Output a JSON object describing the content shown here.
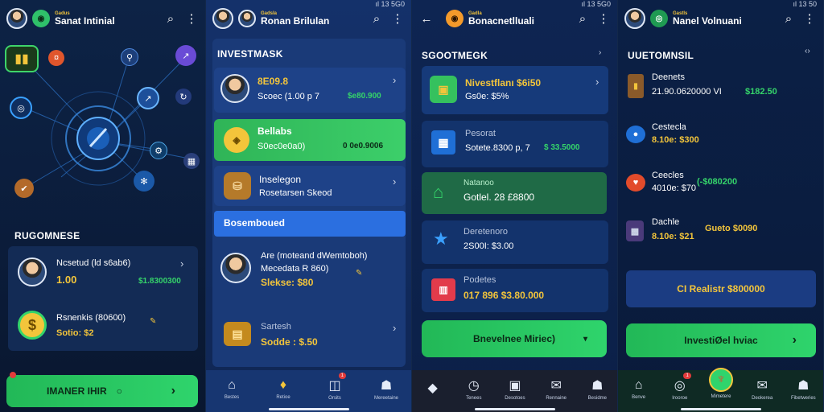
{
  "panels": [
    {
      "brand_small": "Gadus",
      "brand_name": "Sanat Intinial",
      "section_title": "RUGOMNESE",
      "items": [
        {
          "title": "Ncsetud (ld s6ab6)",
          "value": "1.00",
          "amount": "$1.8300300"
        },
        {
          "title": "Rsnenkis (80600)",
          "value": "Sotio: $2",
          "amount": ""
        }
      ],
      "cta": "IMANER IHIR",
      "nav": [
        "",
        "",
        "",
        "",
        ""
      ]
    },
    {
      "status": "ıl 13 5G0",
      "brand_small": "Gadsla",
      "brand_name": "Ronan Brilulan",
      "section_title": "INVESTMASK",
      "items": [
        {
          "line1": "8E09.8",
          "line2": "Scoec (1.00 p 7",
          "amount": "$e80.900"
        },
        {
          "line1": "Bellabs",
          "line2": "S0ec0e0a0)",
          "amount": "0 0e0.9006"
        },
        {
          "line1": "Inselegon",
          "line2": "Rosetarsen Skeod",
          "amount": ""
        },
        {
          "line1": "Are (moteand dWemtoboh)",
          "line2": "Mecedata R 860)",
          "line3": "Slekse: $80"
        },
        {
          "line1": "Sartesh",
          "line2": "Sodde : $.50"
        }
      ],
      "highlight": "Bosemboued",
      "nav": [
        "Bestes",
        "Retioe",
        "Orsits",
        "Mereetaine"
      ],
      "badge": "1"
    },
    {
      "status": "ıl 13 5G0",
      "brand_small": "Gadla",
      "brand_name": "Bonacnetlluali",
      "section_title": "SGOOTMEGK",
      "items": [
        {
          "line1": "Nivestflanı $6i50",
          "line2": "Gs0e: $5%"
        },
        {
          "line1": "Pesorat",
          "line2": "Sotete.8300 p, 7",
          "amount": "$ 33.5000"
        },
        {
          "line1": "Natanoo",
          "line2": "Gotlel. 28 £8800"
        },
        {
          "line1": "Deretenoro",
          "line2": "2S00I: $3.00"
        },
        {
          "line1": "Podetes",
          "line2": "017 896 $3.80.000"
        }
      ],
      "cta": "Bnevelnee Miriec)",
      "nav": [
        "",
        "Tenees",
        "Desotoes",
        "Rennaine",
        "Besidme"
      ]
    },
    {
      "status": "ıl 13 50",
      "brand_small": "Gastls",
      "brand_name": "Nanel Volnuani",
      "section_title": "UUETOMNSIL",
      "items": [
        {
          "line1": "Deenets",
          "line2": "21.90.0620000 VI",
          "amount": "$182.50"
        },
        {
          "line1": "Cestecla",
          "line2": "8.10e: $300"
        },
        {
          "line1": "Ceecles",
          "line2": "4010e: $70",
          "amount": "(-$080200"
        },
        {
          "line1": "Dachle",
          "line2": "8.10e: $21",
          "amount": "Gueto $0090"
        }
      ],
      "pill": "CI Realistr $800000",
      "cta": "InvestiØel hviac",
      "nav": [
        "Benve",
        "Irooroe",
        "Mimetere",
        "Deokerea",
        "Fibetweries"
      ],
      "badge": "1"
    }
  ]
}
